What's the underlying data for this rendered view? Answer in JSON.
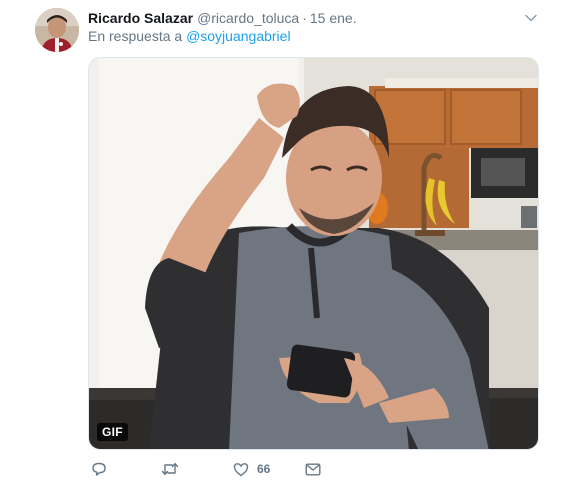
{
  "tweet": {
    "author_name": "Ricardo Salazar",
    "author_handle": "@ricardo_toluca",
    "separator": "·",
    "timestamp": "15 ene.",
    "reply_prefix": "En respuesta a",
    "reply_mention": "@soyjuangabriel",
    "media_badge": "GIF",
    "like_count": "66"
  },
  "colors": {
    "accent": "#1da1f2",
    "secondary_text": "#657786",
    "icon": "#657786"
  },
  "icons": {
    "caret": "chevron-down-icon",
    "reply": "speech-bubble-icon",
    "retweet": "retweet-arrows-icon",
    "like": "heart-icon",
    "dm": "envelope-icon"
  }
}
